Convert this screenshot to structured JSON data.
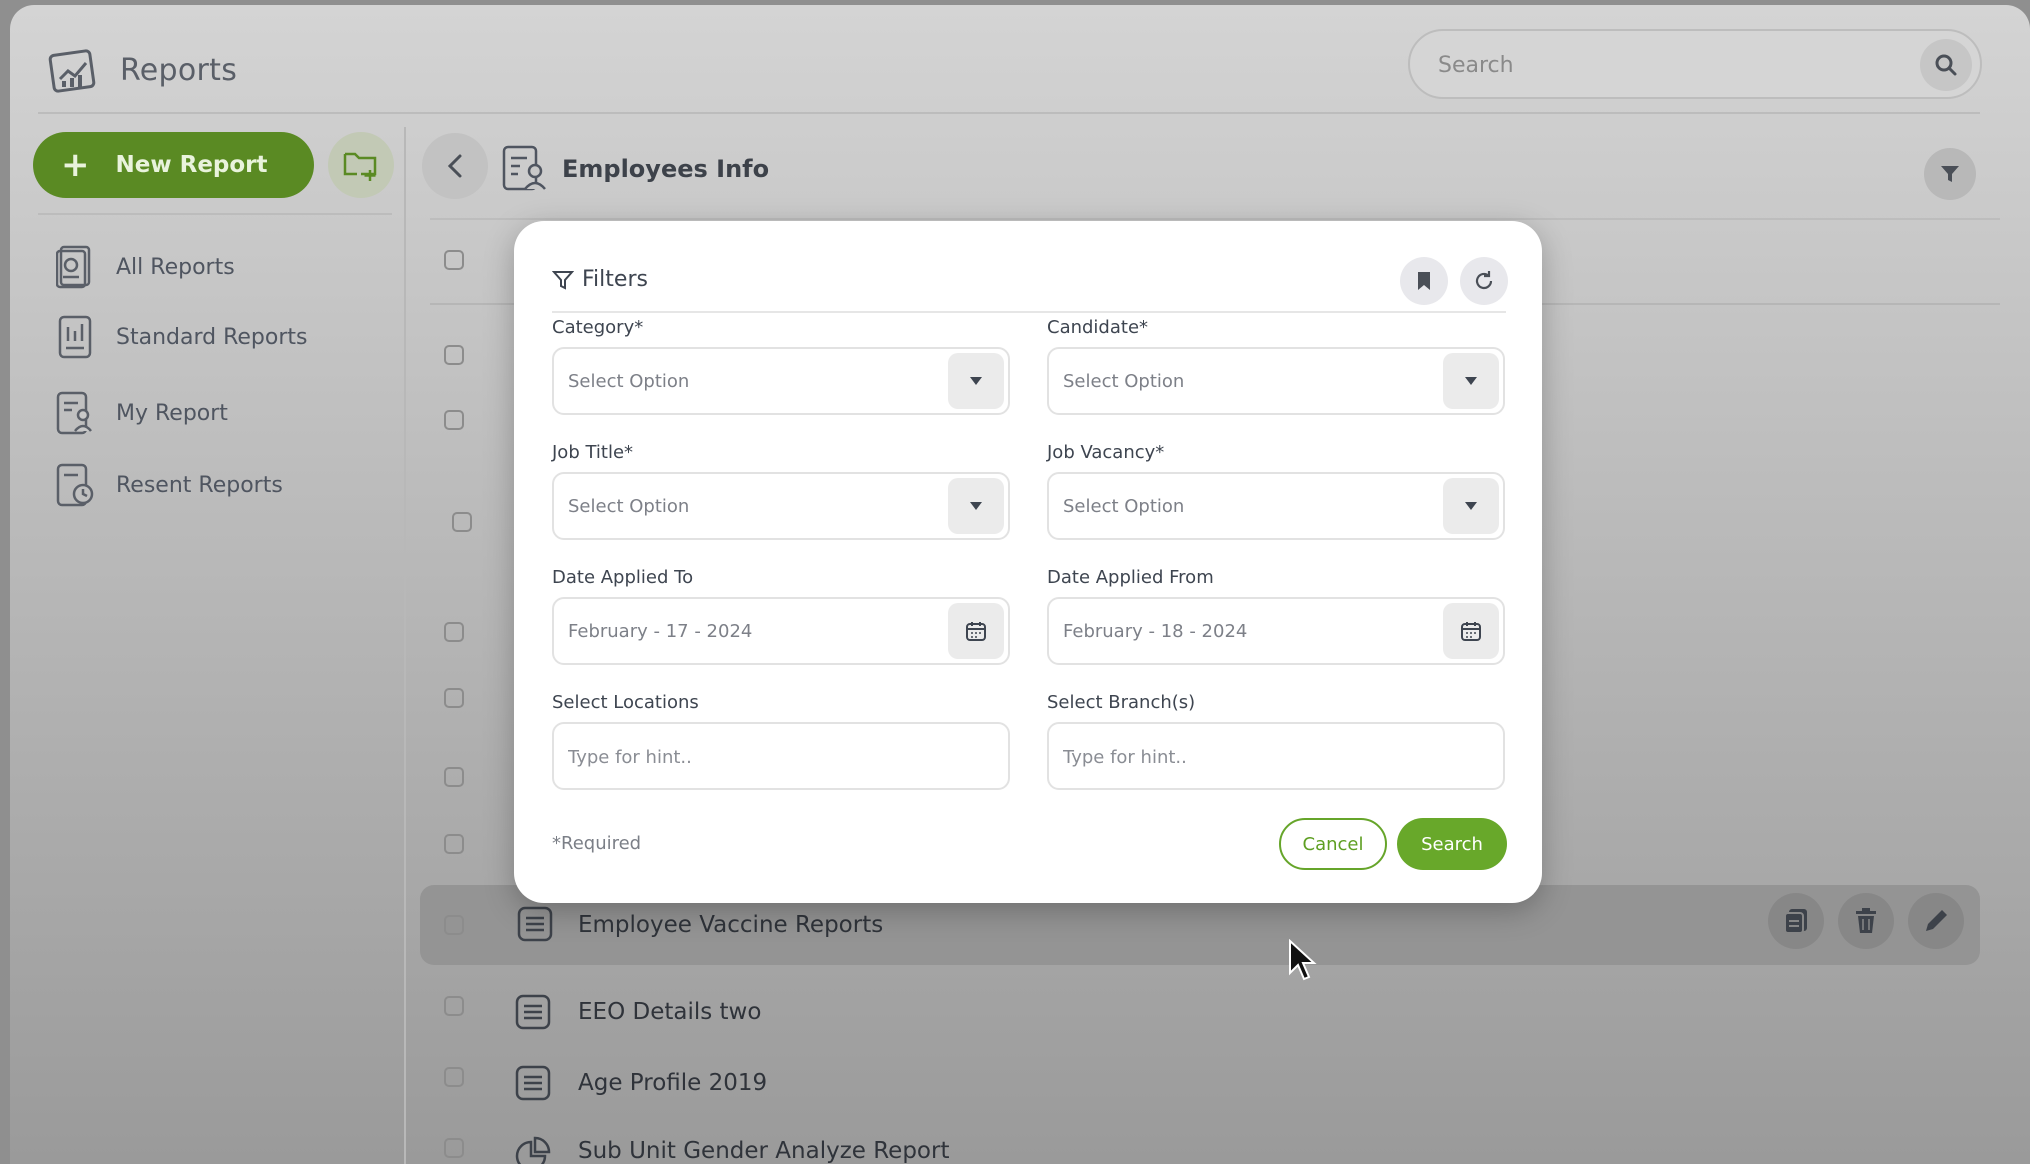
{
  "app": {
    "title": "Reports"
  },
  "search": {
    "placeholder": "Search"
  },
  "sidebar": {
    "new_report_label": "New Report",
    "items": [
      {
        "label": "All Reports",
        "icon": "all-reports-icon"
      },
      {
        "label": "Standard Reports",
        "icon": "standard-reports-icon"
      },
      {
        "label": "My Report",
        "icon": "my-report-icon"
      },
      {
        "label": "Resent Reports",
        "icon": "recent-reports-icon"
      }
    ]
  },
  "main": {
    "title": "Employees Info",
    "rows": [
      {
        "name": "Employee Vaccine Reports",
        "icon": "list-doc-icon"
      },
      {
        "name": "EEO Details two",
        "icon": "list-doc-icon"
      },
      {
        "name": "Age Profile 2019",
        "icon": "list-doc-icon"
      },
      {
        "name": "Sub Unit Gender Analyze Report",
        "icon": "pie-chart-icon"
      }
    ]
  },
  "filters": {
    "title": "Filters",
    "category": {
      "label": "Category*",
      "value": "Select Option"
    },
    "candidate": {
      "label": "Candidate*",
      "value": "Select Option"
    },
    "job_title": {
      "label": "Job Title*",
      "value": "Select Option"
    },
    "job_vacancy": {
      "label": "Job Vacancy*",
      "value": "Select Option"
    },
    "date_to": {
      "label": "Date Applied To",
      "value": "February - 17 - 2024"
    },
    "date_from": {
      "label": "Date Applied From",
      "value": "February - 18 - 2024"
    },
    "locations": {
      "label": "Select Locations",
      "placeholder": "Type for hint.."
    },
    "branches": {
      "label": "Select Branch(s)",
      "placeholder": "Type for hint.."
    },
    "required_note": "*Required",
    "cancel_label": "Cancel",
    "search_label": "Search"
  },
  "colors": {
    "accent": "#68a82a",
    "sidebar_button": "#5a8a23"
  }
}
